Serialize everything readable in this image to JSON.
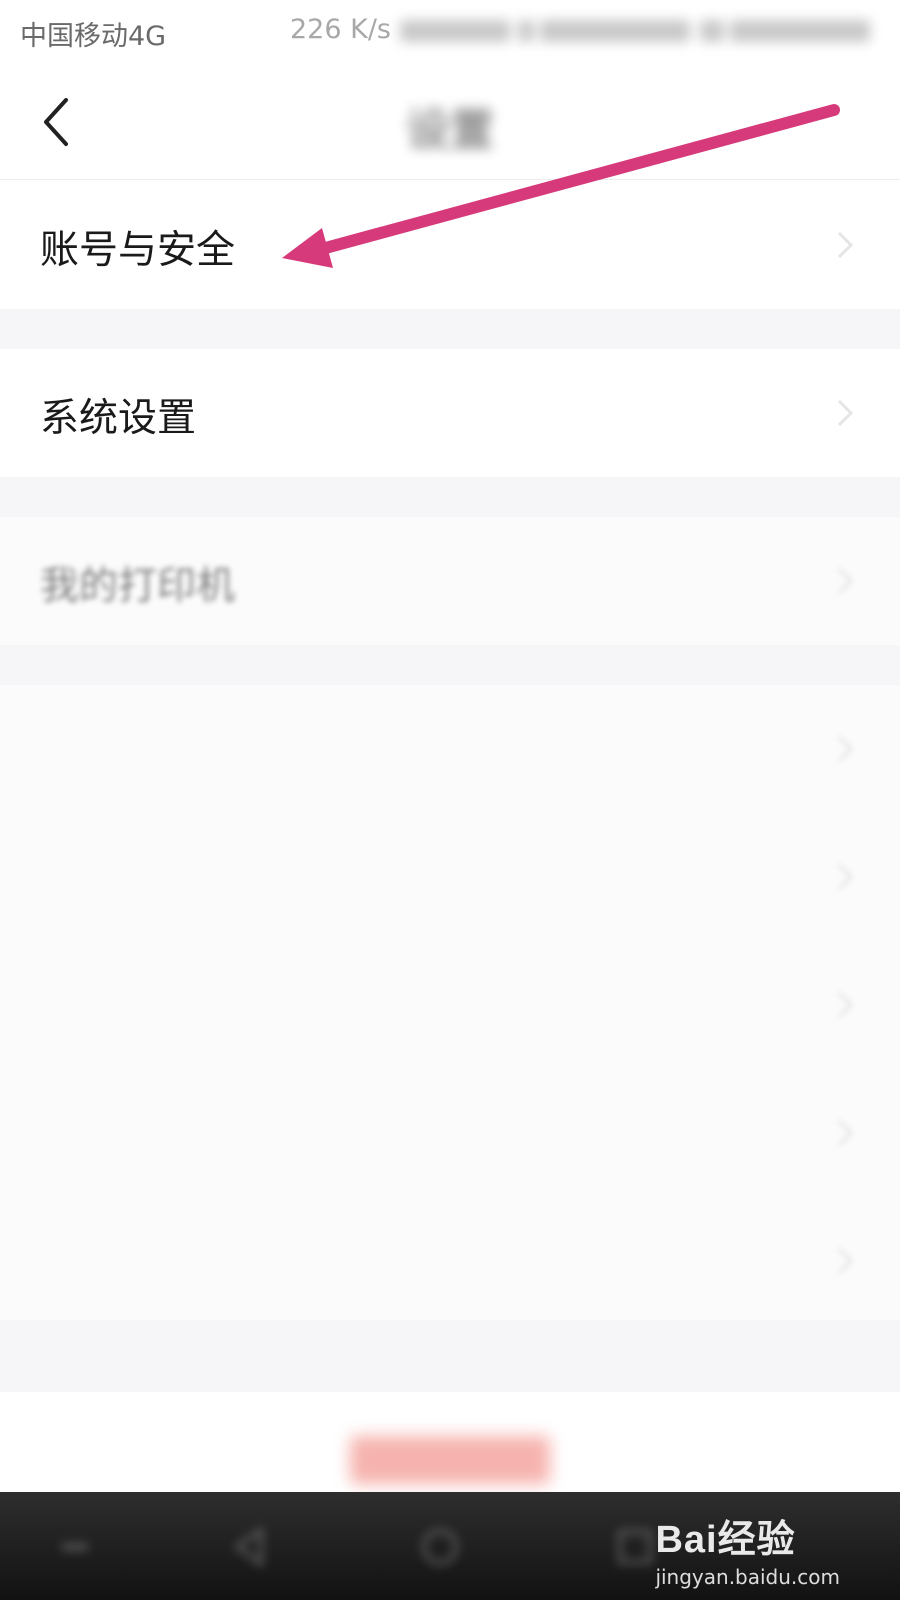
{
  "status_bar": {
    "carrier": "中国移动4G",
    "net_speed": "226 K/s"
  },
  "nav": {
    "back_icon": "chevron-left-icon",
    "title": "设置"
  },
  "settings": {
    "items": [
      {
        "label": "账号与安全",
        "icon": "chevron-right-icon"
      },
      {
        "label": "系统设置",
        "icon": "chevron-right-icon"
      },
      {
        "label": "我的打印机",
        "icon": "chevron-right-icon"
      },
      {
        "label": "",
        "icon": "chevron-right-icon"
      },
      {
        "label": "",
        "icon": "chevron-right-icon"
      },
      {
        "label": "",
        "icon": "chevron-right-icon"
      },
      {
        "label": "",
        "icon": "chevron-right-icon"
      },
      {
        "label": "",
        "icon": "chevron-right-icon"
      }
    ]
  },
  "logout": {
    "label": ""
  },
  "annotation": {
    "color": "#d63a7a",
    "target": "账号与安全"
  },
  "watermark": {
    "brand": "Bai经验",
    "sub": "jingyan.baidu.com"
  },
  "colors": {
    "page_bg": "#ffffff",
    "section_gap": "#f6f6f8",
    "arrow": "#d63a7a",
    "logout": "#f4a09a",
    "nav_bar": "#1e1e1e"
  }
}
